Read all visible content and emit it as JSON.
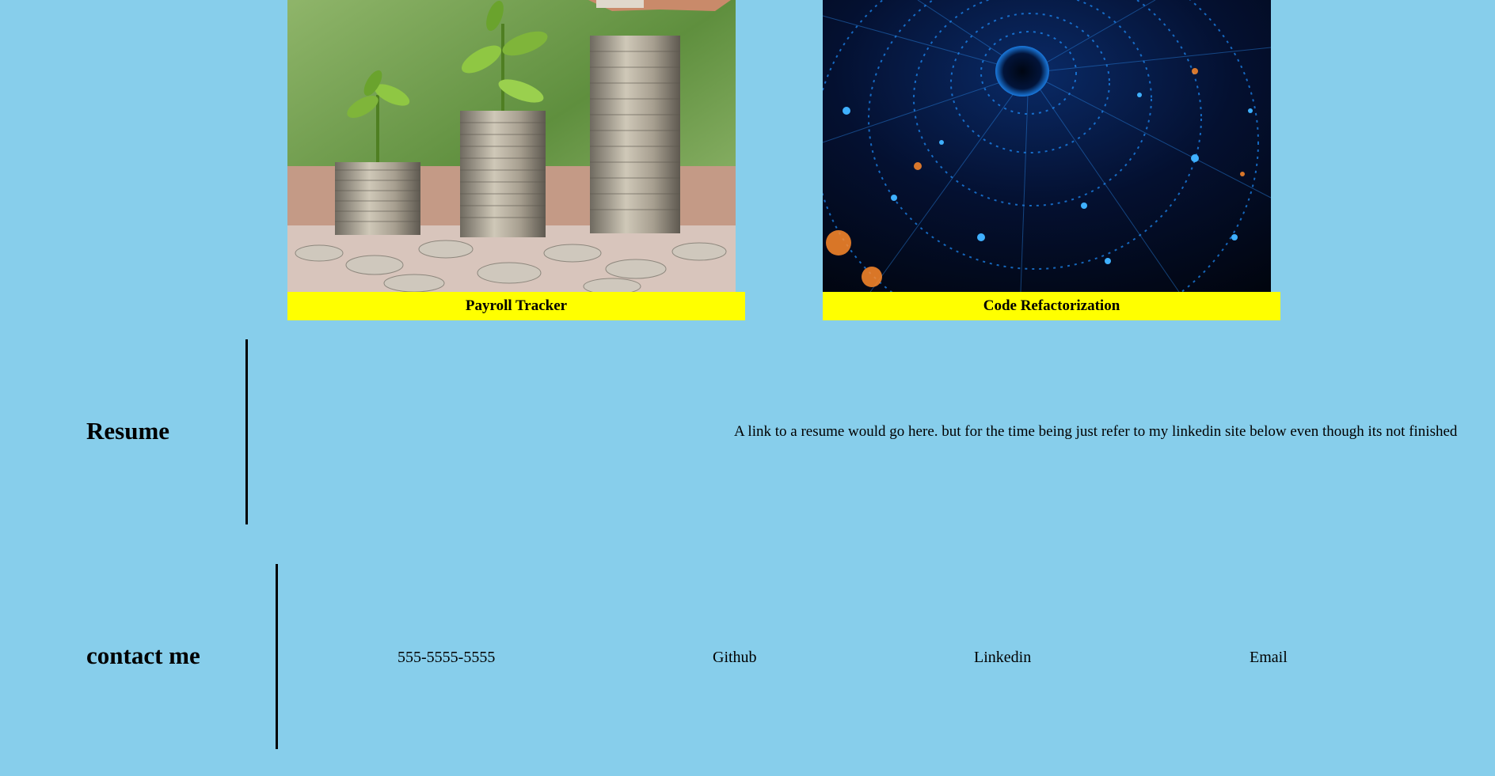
{
  "projects": [
    {
      "title": "Payroll Tracker",
      "image": "coin-stacks-with-plants"
    },
    {
      "title": "Code Refactorization",
      "image": "blue-digital-tunnel"
    }
  ],
  "resume": {
    "title": "Resume",
    "text": "A link to a resume would go here. but for the time being just refer to my linkedin site below even though its not finished"
  },
  "contact": {
    "title": "contact me",
    "phone": "555-5555-5555",
    "github": "Github",
    "linkedin": "Linkedin",
    "email": "Email"
  },
  "colors": {
    "background": "#87ceeb",
    "caption_bg": "#ffff00"
  }
}
